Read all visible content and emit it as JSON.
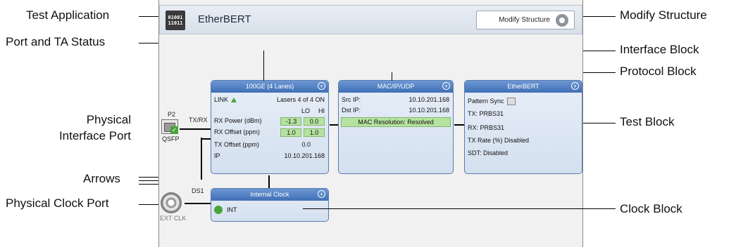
{
  "callouts": {
    "test_application": "Test Application",
    "port_ta_status": "Port and TA Status",
    "physical_interface_port_1": "Physical",
    "physical_interface_port_2": "Interface Port",
    "arrows": "Arrows",
    "physical_clock_port": "Physical Clock Port",
    "modify_structure": "Modify Structure",
    "interface_block": "Interface Block",
    "protocol_block": "Protocol Block",
    "test_block": "Test Block",
    "clock_block": "Clock Block"
  },
  "app": {
    "icon_top": "01001",
    "icon_bottom": "11011",
    "title": "EtherBERT",
    "modify_button": "Modify Structure"
  },
  "port": {
    "name": "P2",
    "direction": "TX/RX",
    "type": "QSFP",
    "clock_port_label": "DS1",
    "ext_clk": "EXT CLK"
  },
  "interface_block": {
    "title": "100GE (4 Lanes)",
    "link": "LINK",
    "lasers": "Lasers 4 of 4 ON",
    "lo": "LO",
    "hi": "HI",
    "rx_power_label": "RX Power (dBm)",
    "rx_power_lo": "-1.3",
    "rx_power_hi": "0.0",
    "rx_offset_label": "RX Offset (ppm)",
    "rx_offset_lo": "1.0",
    "rx_offset_hi": "1.0",
    "tx_offset_label": "TX Offset (ppm)",
    "tx_offset_val": "0.0",
    "ip_label": "IP",
    "ip_val": "10.10.201.168"
  },
  "protocol_block": {
    "title": "MAC/IP/UDP",
    "src_ip_label": "Src IP:",
    "src_ip": "10.10.201.168",
    "dst_ip_label": "Dst IP:",
    "dst_ip": "10.10.201.168",
    "mac_resolution": "MAC Resolution: Resolved"
  },
  "test_block": {
    "title": "EtherBERT",
    "pattern_sync": "Pattern Sync",
    "tx": "TX:  PRBS31",
    "rx": "RX:  PRBS31",
    "tx_rate": "TX Rate (%)  Disabled",
    "sdt": "SDT:  Disabled"
  },
  "clock_block": {
    "title": "Internal Clock",
    "value": "INT"
  },
  "colors": {
    "block_header": "#3f6fb6",
    "status_green": "#b6e2a0"
  }
}
